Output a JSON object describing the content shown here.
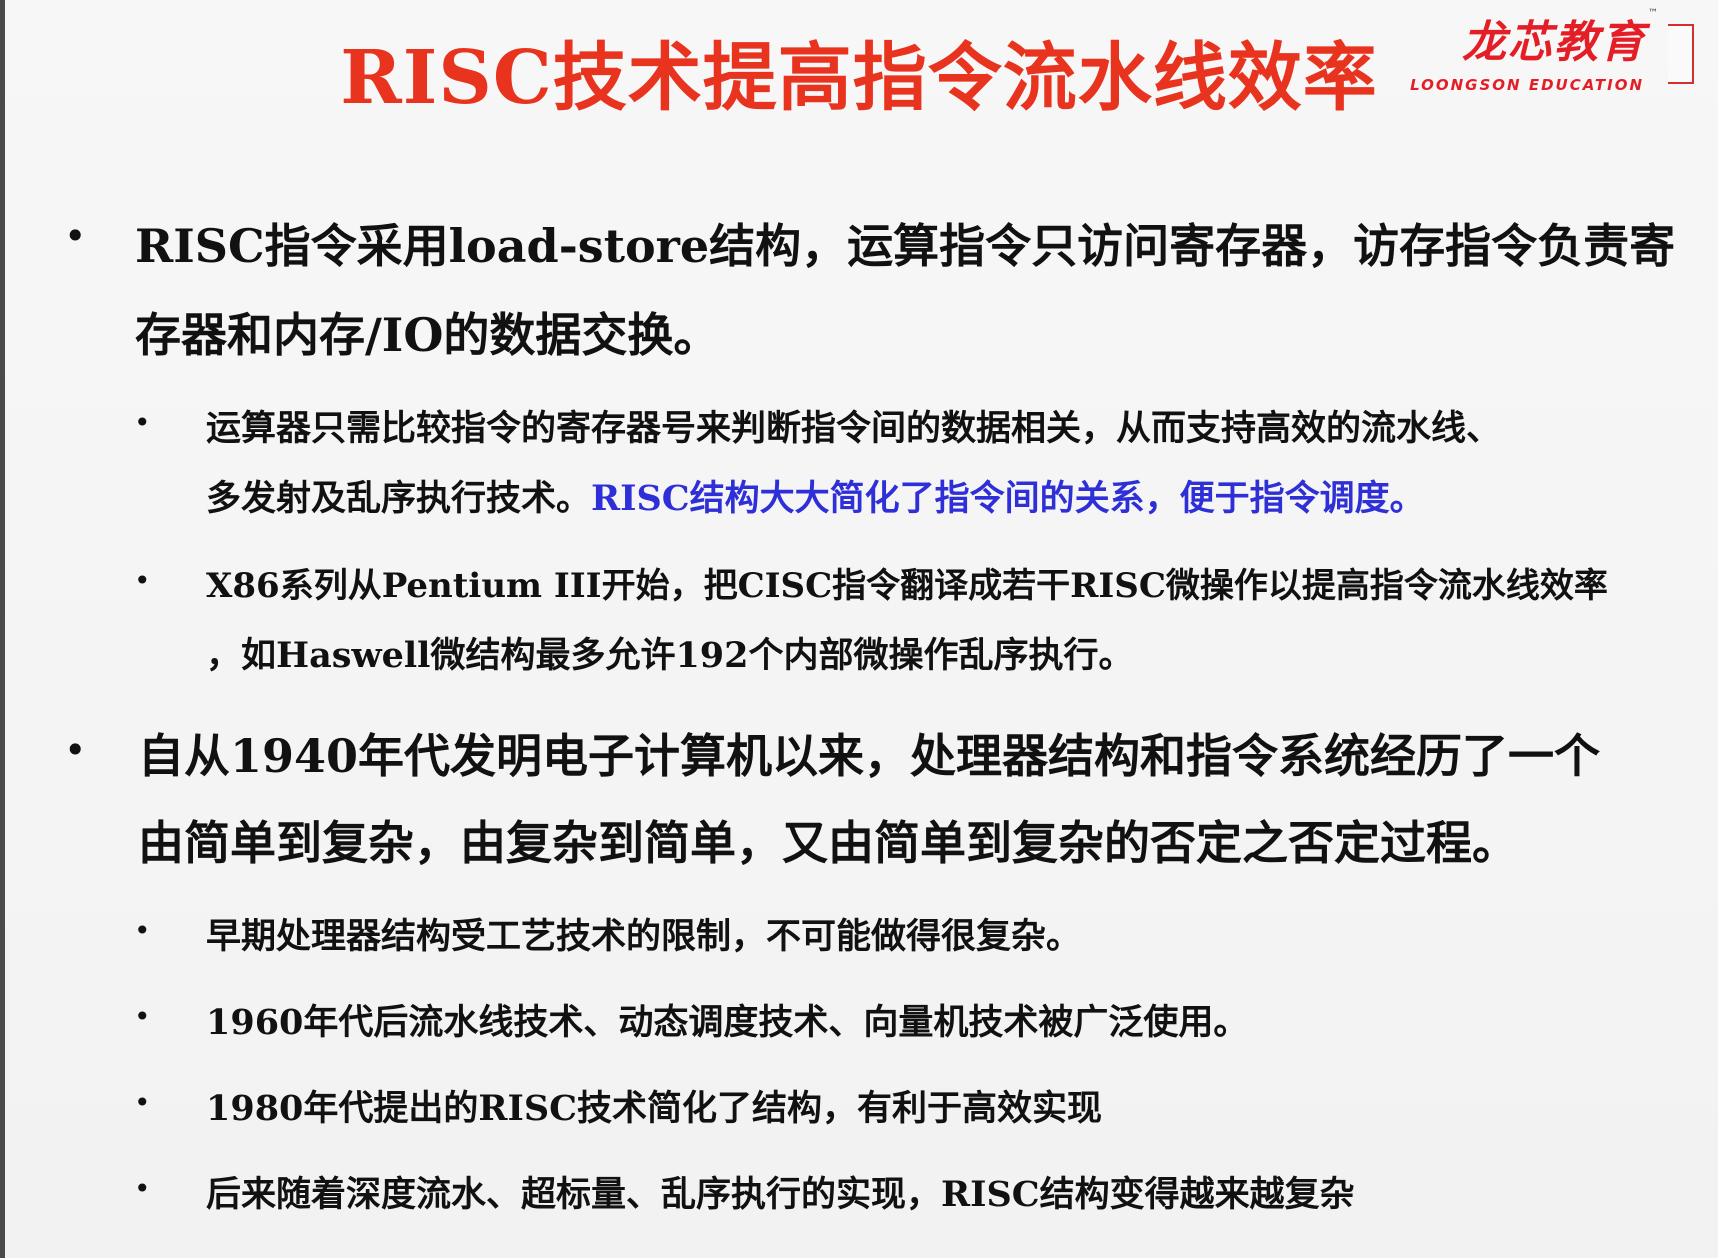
{
  "title": "RISC技术提高指令流水线效率",
  "logo": {
    "name_cn": "龙芯教育",
    "tm": "™",
    "name_en": "LOONGSON EDUCATION"
  },
  "bullets": [
    {
      "level": 1,
      "lines": [
        "RISC指令采用load-store结构，运算指令只访问寄存器，访存指令负责寄",
        "存器和内存/IO的数据交换。"
      ]
    },
    {
      "level": 2,
      "lines": [
        "运算器只需比较指令的寄存器号来判断指令间的数据相关，从而支持高效的流水线、",
        "多发射及乱序执行技术。"
      ],
      "highlight": "RISC结构大大简化了指令间的关系，便于指令调度。"
    },
    {
      "level": 2,
      "lines": [
        "X86系列从Pentium III开始，把CISC指令翻译成若干RISC微操作以提高指令流水线效率",
        "，如Haswell微结构最多允许192个内部微操作乱序执行。"
      ]
    },
    {
      "level": 1,
      "lines": [
        "自从1940年代发明电子计算机以来，处理器结构和指令系统经历了一个",
        "由简单到复杂，由复杂到简单，又由简单到复杂的否定之否定过程。"
      ]
    },
    {
      "level": 2,
      "lines": [
        "早期处理器结构受工艺技术的限制，不可能做得很复杂。"
      ]
    },
    {
      "level": 2,
      "lines": [
        "1960年代后流水线技术、动态调度技术、向量机技术被广泛使用。"
      ]
    },
    {
      "level": 2,
      "lines": [
        "1980年代提出的RISC技术简化了结构，有利于高效实现"
      ]
    },
    {
      "level": 2,
      "lines": [
        "后来随着深度流水、超标量、乱序执行的实现，RISC结构变得越来越复杂"
      ]
    }
  ],
  "bullet_char": "•",
  "colors": {
    "title": "#e8341f",
    "highlight": "#2f2fd8",
    "logo": "#e41e26"
  }
}
